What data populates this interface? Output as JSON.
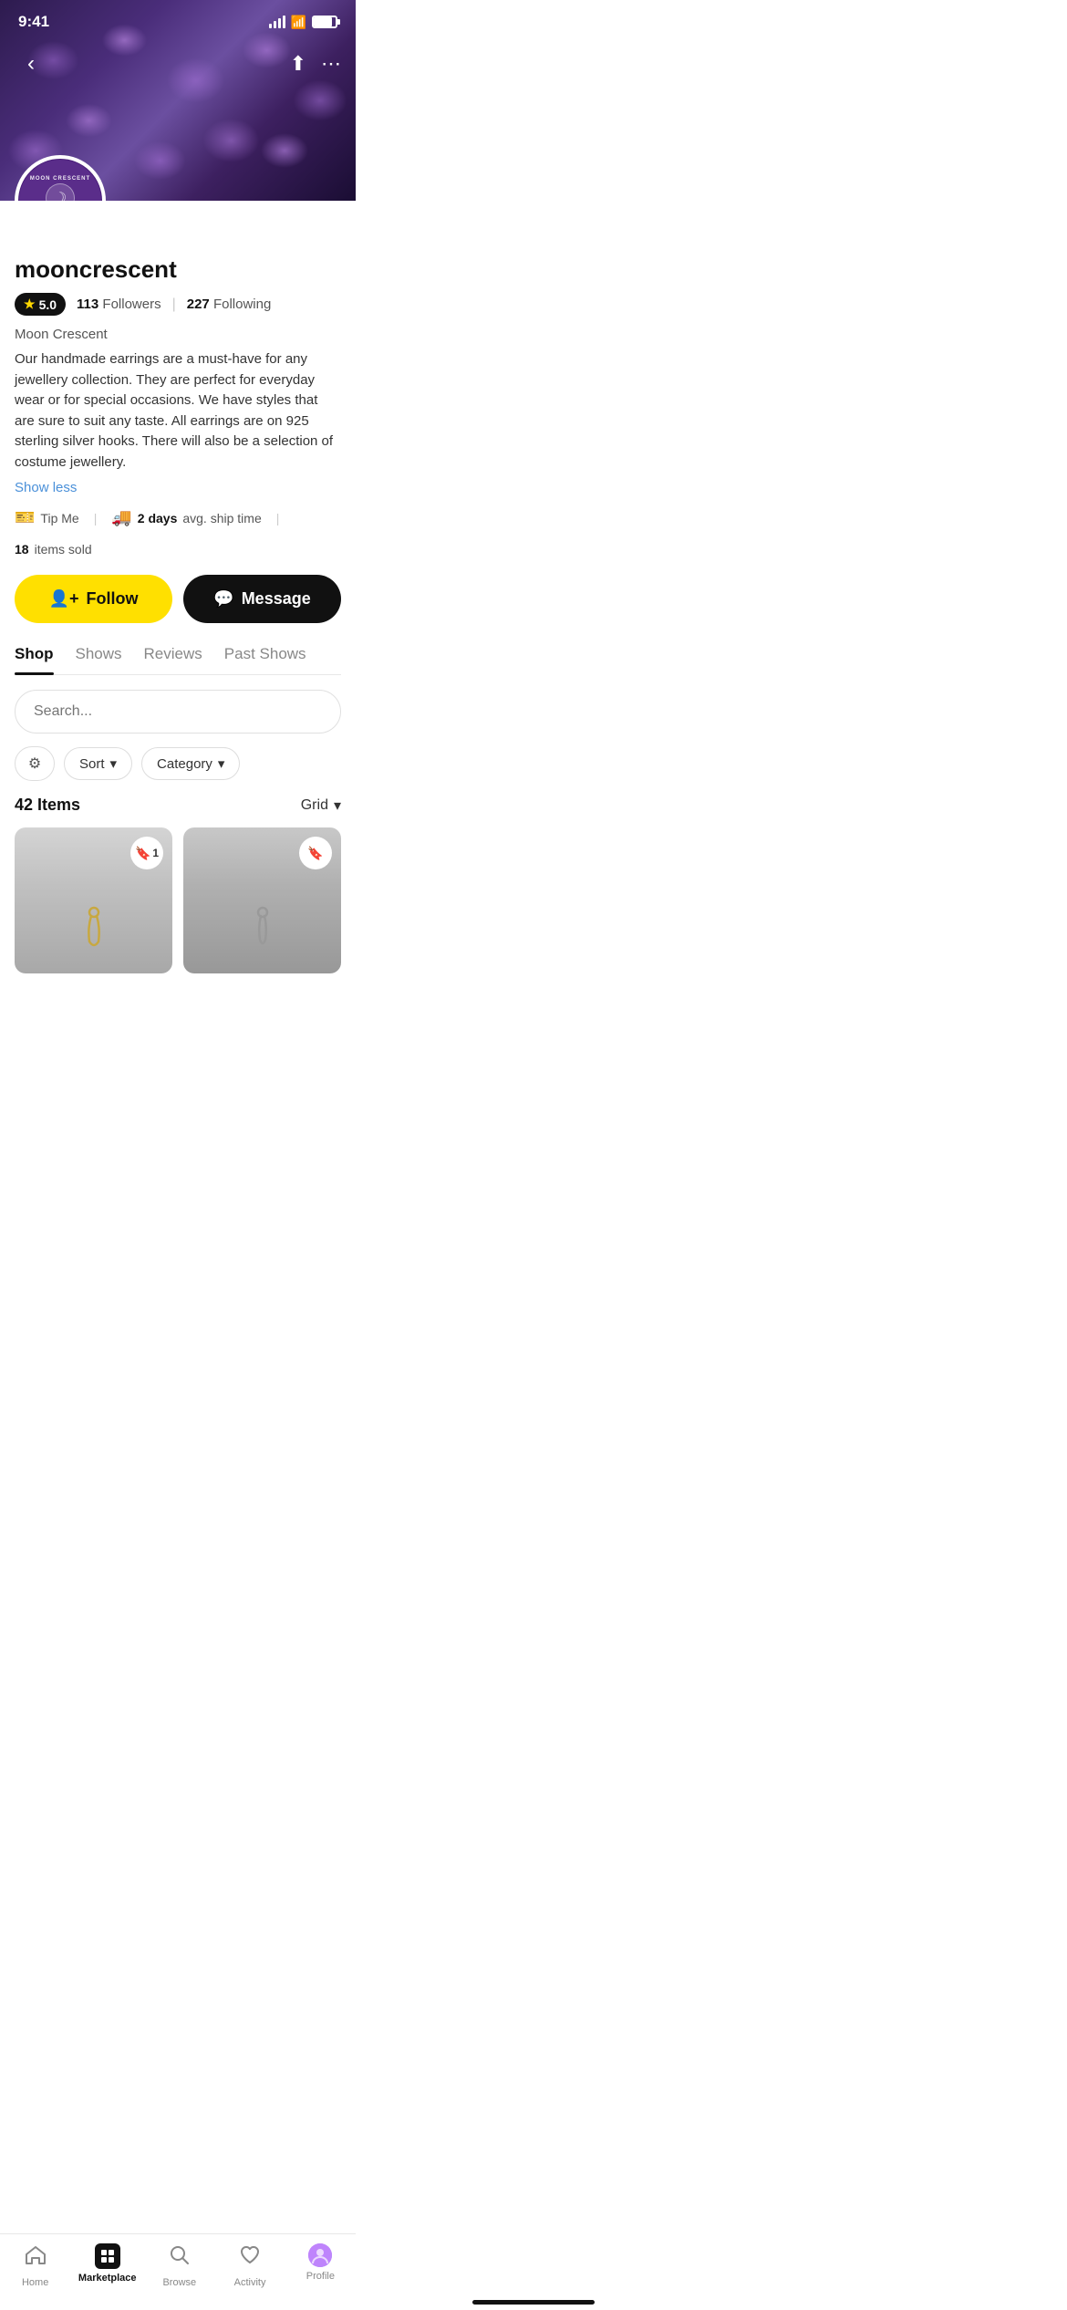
{
  "statusBar": {
    "time": "9:41"
  },
  "header": {
    "backIcon": "←",
    "shareIcon": "⬆",
    "moreIcon": "···"
  },
  "profile": {
    "shopName": "mooncrescent",
    "rating": "5.0",
    "followers": "113",
    "followersLabel": "Followers",
    "following": "227",
    "followingLabel": "Following",
    "tagline": "Moon Crescent",
    "description": "Our handmade earrings are a must-have for any jewellery collection. They are perfect for everyday wear or for special occasions. We have styles that are sure to suit any taste. All earrings are on 925 sterling silver hooks. There will also be a selection of costume jewellery.",
    "showLessLabel": "Show less",
    "tipLabel": "Tip Me",
    "shipDays": "2 days",
    "shipLabel": "avg. ship time",
    "itemsSold": "18",
    "itemsSoldLabel": "items sold"
  },
  "actions": {
    "followLabel": "Follow",
    "messageLabel": "Message"
  },
  "tabs": [
    {
      "id": "shop",
      "label": "Shop",
      "active": true
    },
    {
      "id": "shows",
      "label": "Shows",
      "active": false
    },
    {
      "id": "reviews",
      "label": "Reviews",
      "active": false
    },
    {
      "id": "past-shows",
      "label": "Past Shows",
      "active": false
    }
  ],
  "search": {
    "placeholder": "Search..."
  },
  "filters": {
    "sortLabel": "Sort",
    "categoryLabel": "Category",
    "chevron": "▾"
  },
  "items": {
    "count": "42 Items",
    "viewMode": "Grid",
    "products": [
      {
        "id": 1,
        "bookmarkCount": "1",
        "hasCount": true
      },
      {
        "id": 2,
        "bookmarkCount": "",
        "hasCount": false
      }
    ]
  },
  "bottomNav": [
    {
      "id": "home",
      "label": "Home",
      "icon": "🏠",
      "active": false
    },
    {
      "id": "marketplace",
      "label": "Marketplace",
      "icon": "market",
      "active": true
    },
    {
      "id": "browse",
      "label": "Browse",
      "icon": "🔍",
      "active": false
    },
    {
      "id": "activity",
      "label": "Activity",
      "icon": "♡",
      "active": false
    },
    {
      "id": "profile",
      "label": "Profile",
      "icon": "person",
      "active": false
    }
  ]
}
